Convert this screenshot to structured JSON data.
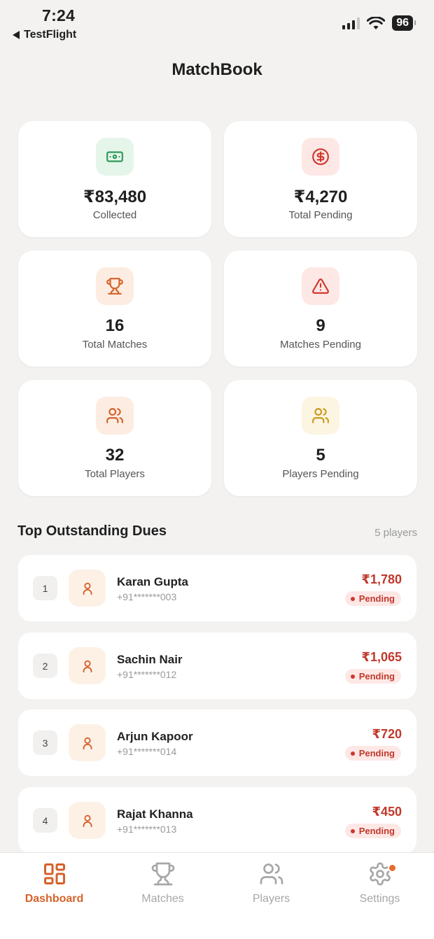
{
  "status_bar": {
    "time": "7:24",
    "back_app": "TestFlight",
    "battery": "96"
  },
  "header": {
    "title": "MatchBook"
  },
  "stats": [
    {
      "value": "₹83,480",
      "label": "Collected",
      "icon": "banknote-icon",
      "icon_color": "#2e9a5a",
      "icon_bg": "#e6f5ea"
    },
    {
      "value": "₹4,270",
      "label": "Total Pending",
      "icon": "dollar-circle-icon",
      "icon_color": "#d0372e",
      "icon_bg": "#fde8e6"
    },
    {
      "value": "16",
      "label": "Total Matches",
      "icon": "trophy-icon",
      "icon_color": "#d4622a",
      "icon_bg": "#fdece2"
    },
    {
      "value": "9",
      "label": "Matches Pending",
      "icon": "alert-triangle-icon",
      "icon_color": "#d0372e",
      "icon_bg": "#fde8e6"
    },
    {
      "value": "32",
      "label": "Total Players",
      "icon": "users-icon",
      "icon_color": "#d4622a",
      "icon_bg": "#fdece2"
    },
    {
      "value": "5",
      "label": "Players Pending",
      "icon": "users-icon",
      "icon_color": "#c99a1e",
      "icon_bg": "#fcf5e2"
    }
  ],
  "dues": {
    "title": "Top Outstanding Dues",
    "meta": "5 players",
    "rows": [
      {
        "rank": "1",
        "name": "Karan Gupta",
        "phone": "+91*******003",
        "amount": "₹1,780",
        "status": "Pending"
      },
      {
        "rank": "2",
        "name": "Sachin Nair",
        "phone": "+91*******012",
        "amount": "₹1,065",
        "status": "Pending"
      },
      {
        "rank": "3",
        "name": "Arjun Kapoor",
        "phone": "+91*******014",
        "amount": "₹720",
        "status": "Pending"
      },
      {
        "rank": "4",
        "name": "Rajat Khanna",
        "phone": "+91*******013",
        "amount": "₹450",
        "status": "Pending"
      }
    ]
  },
  "tabs": [
    {
      "label": "Dashboard",
      "icon": "grid-icon",
      "active": true
    },
    {
      "label": "Matches",
      "icon": "trophy-icon",
      "active": false
    },
    {
      "label": "Players",
      "icon": "users-icon",
      "active": false
    },
    {
      "label": "Settings",
      "icon": "gear-icon",
      "active": false
    }
  ],
  "colors": {
    "accent": "#d4622a",
    "danger": "#c0392b",
    "background": "#f3f2f1"
  }
}
